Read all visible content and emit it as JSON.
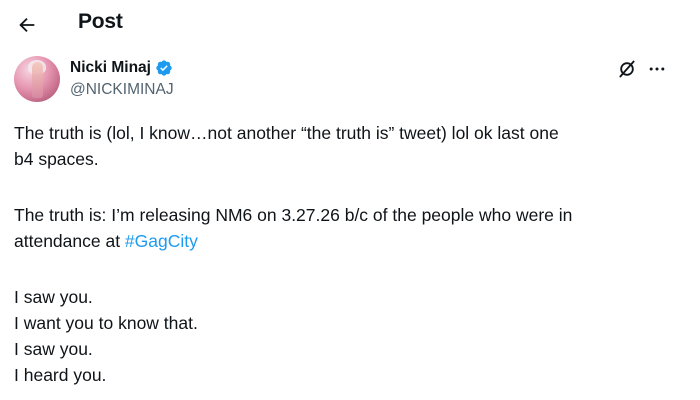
{
  "header": {
    "title": "Post",
    "back_icon": "arrow-left-icon"
  },
  "author": {
    "display_name": "Nicki Minaj",
    "handle": "@NICKIMINAJ",
    "verified": true,
    "verified_color": "#1d9bf0"
  },
  "actions": {
    "grok_icon": "grok-icon",
    "more_icon": "more-horizontal-icon"
  },
  "tweet": {
    "para1_line1": "The truth is (lol, I know…not another “the truth is” tweet) lol ok last one",
    "para1_line2": "b4 spaces.",
    "para2_line1": "The truth is: I’m releasing NM6 on 3.27.26 b/c of the people who were in",
    "para2_line2_prefix": "attendance at ",
    "hashtag": "#GagCity",
    "line3": "I saw you.",
    "line4": "I want you to know that.",
    "line5": "I saw you.",
    "line6": "I heard you."
  },
  "colors": {
    "text": "#0f1419",
    "secondary": "#536471",
    "link": "#1d9bf0"
  }
}
